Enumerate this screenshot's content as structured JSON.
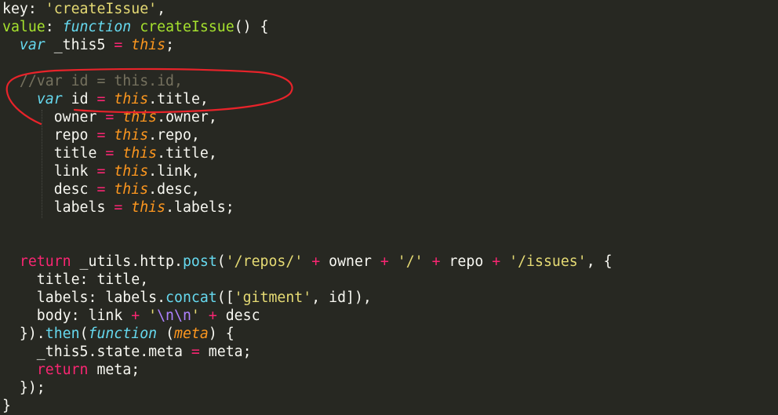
{
  "editor": {
    "theme": {
      "background": "#272822",
      "plain": "#f8f8f2",
      "keyword": "#f92672",
      "string": "#e6db74",
      "function_name": "#a6e22e",
      "storage": "#66d9ef",
      "this": "#fd971f",
      "comment": "#75715e",
      "escape": "#ae81ff",
      "annotation": "#e8232a"
    },
    "lines": [
      [
        {
          "t": "key: ",
          "c": "pl"
        },
        {
          "t": "'createIssue'",
          "c": "str"
        },
        {
          "t": ",",
          "c": "pl"
        }
      ],
      [
        {
          "t": "value",
          "c": "fn"
        },
        {
          "t": ": ",
          "c": "pl"
        },
        {
          "t": "function",
          "c": "st"
        },
        {
          "t": " ",
          "c": "pl"
        },
        {
          "t": "createIssue",
          "c": "fn"
        },
        {
          "t": "() {",
          "c": "pl"
        }
      ],
      [
        {
          "t": "  ",
          "c": "pl"
        },
        {
          "t": "var",
          "c": "st"
        },
        {
          "t": " _this5 ",
          "c": "pl"
        },
        {
          "t": "=",
          "c": "op"
        },
        {
          "t": " ",
          "c": "pl"
        },
        {
          "t": "this",
          "c": "this"
        },
        {
          "t": ";",
          "c": "pl"
        }
      ],
      [],
      [
        {
          "t": "  ",
          "c": "pl"
        },
        {
          "t": "//var id = this.id,",
          "c": "cmt"
        }
      ],
      [
        {
          "t": "    ",
          "c": "pl"
        },
        {
          "t": "var",
          "c": "st"
        },
        {
          "t": " id ",
          "c": "pl"
        },
        {
          "t": "=",
          "c": "op"
        },
        {
          "t": " ",
          "c": "pl"
        },
        {
          "t": "this",
          "c": "this"
        },
        {
          "t": ".title,",
          "c": "pl"
        }
      ],
      [
        {
          "t": "      owner ",
          "c": "pl"
        },
        {
          "t": "=",
          "c": "op"
        },
        {
          "t": " ",
          "c": "pl"
        },
        {
          "t": "this",
          "c": "this"
        },
        {
          "t": ".owner,",
          "c": "pl"
        }
      ],
      [
        {
          "t": "      repo ",
          "c": "pl"
        },
        {
          "t": "=",
          "c": "op"
        },
        {
          "t": " ",
          "c": "pl"
        },
        {
          "t": "this",
          "c": "this"
        },
        {
          "t": ".repo,",
          "c": "pl"
        }
      ],
      [
        {
          "t": "      title ",
          "c": "pl"
        },
        {
          "t": "=",
          "c": "op"
        },
        {
          "t": " ",
          "c": "pl"
        },
        {
          "t": "this",
          "c": "this"
        },
        {
          "t": ".title,",
          "c": "pl"
        }
      ],
      [
        {
          "t": "      link ",
          "c": "pl"
        },
        {
          "t": "=",
          "c": "op"
        },
        {
          "t": " ",
          "c": "pl"
        },
        {
          "t": "this",
          "c": "this"
        },
        {
          "t": ".link,",
          "c": "pl"
        }
      ],
      [
        {
          "t": "      desc ",
          "c": "pl"
        },
        {
          "t": "=",
          "c": "op"
        },
        {
          "t": " ",
          "c": "pl"
        },
        {
          "t": "this",
          "c": "this"
        },
        {
          "t": ".desc,",
          "c": "pl"
        }
      ],
      [
        {
          "t": "      labels ",
          "c": "pl"
        },
        {
          "t": "=",
          "c": "op"
        },
        {
          "t": " ",
          "c": "pl"
        },
        {
          "t": "this",
          "c": "this"
        },
        {
          "t": ".labels;",
          "c": "pl"
        }
      ],
      [],
      [],
      [
        {
          "t": "  ",
          "c": "pl"
        },
        {
          "t": "return",
          "c": "kw"
        },
        {
          "t": " _utils.http.",
          "c": "pl"
        },
        {
          "t": "post",
          "c": "meth"
        },
        {
          "t": "(",
          "c": "pl"
        },
        {
          "t": "'/repos/'",
          "c": "str"
        },
        {
          "t": " ",
          "c": "pl"
        },
        {
          "t": "+",
          "c": "op"
        },
        {
          "t": " owner ",
          "c": "pl"
        },
        {
          "t": "+",
          "c": "op"
        },
        {
          "t": " ",
          "c": "pl"
        },
        {
          "t": "'/'",
          "c": "str"
        },
        {
          "t": " ",
          "c": "pl"
        },
        {
          "t": "+",
          "c": "op"
        },
        {
          "t": " repo ",
          "c": "pl"
        },
        {
          "t": "+",
          "c": "op"
        },
        {
          "t": " ",
          "c": "pl"
        },
        {
          "t": "'/issues'",
          "c": "str"
        },
        {
          "t": ", {",
          "c": "pl"
        }
      ],
      [
        {
          "t": "    title: title,",
          "c": "pl"
        }
      ],
      [
        {
          "t": "    labels: labels.",
          "c": "pl"
        },
        {
          "t": "concat",
          "c": "meth"
        },
        {
          "t": "([",
          "c": "pl"
        },
        {
          "t": "'gitment'",
          "c": "str"
        },
        {
          "t": ", id]),",
          "c": "pl"
        }
      ],
      [
        {
          "t": "    body: link ",
          "c": "pl"
        },
        {
          "t": "+",
          "c": "op"
        },
        {
          "t": " ",
          "c": "pl"
        },
        {
          "t": "'",
          "c": "str"
        },
        {
          "t": "\\n\\n",
          "c": "esc"
        },
        {
          "t": "'",
          "c": "str"
        },
        {
          "t": " ",
          "c": "pl"
        },
        {
          "t": "+",
          "c": "op"
        },
        {
          "t": " desc",
          "c": "pl"
        }
      ],
      [
        {
          "t": "  }).",
          "c": "pl"
        },
        {
          "t": "then",
          "c": "meth"
        },
        {
          "t": "(",
          "c": "pl"
        },
        {
          "t": "function",
          "c": "st"
        },
        {
          "t": " (",
          "c": "pl"
        },
        {
          "t": "meta",
          "c": "prm"
        },
        {
          "t": ") {",
          "c": "pl"
        }
      ],
      [
        {
          "t": "    _this5.state.meta ",
          "c": "pl"
        },
        {
          "t": "=",
          "c": "op"
        },
        {
          "t": " meta;",
          "c": "pl"
        }
      ],
      [
        {
          "t": "    ",
          "c": "pl"
        },
        {
          "t": "return",
          "c": "kw"
        },
        {
          "t": " meta;",
          "c": "pl"
        }
      ],
      [
        {
          "t": "  });",
          "c": "pl"
        }
      ],
      [
        {
          "t": "}",
          "c": "pl"
        }
      ]
    ]
  }
}
